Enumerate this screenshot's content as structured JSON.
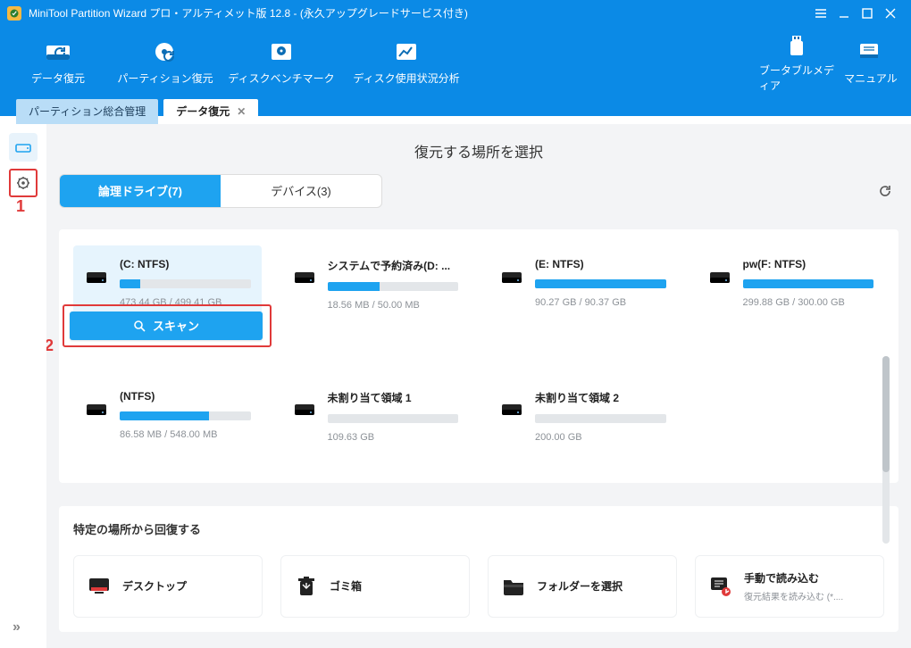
{
  "window": {
    "title": "MiniTool Partition Wizard プロ・アルティメット版 12.8 - (永久アップグレードサービス付き)"
  },
  "toolbar": {
    "data_recovery": "データ復元",
    "partition_recovery": "パーティション復元",
    "disk_benchmark": "ディスクベンチマーク",
    "disk_usage": "ディスク使用状況分析",
    "bootable_media": "ブータブルメディア",
    "manual": "マニュアル"
  },
  "tabs": {
    "tab1": "パーティション総合管理",
    "tab2": "データ復元"
  },
  "main": {
    "heading": "復元する場所を選択",
    "seg_logical": "論理ドライブ(7)",
    "seg_device": "デバイス(3)"
  },
  "drives": [
    {
      "name": "(C: NTFS)",
      "size": "473.44 GB / 499.41 GB",
      "fill": 16
    },
    {
      "name": "システムで予約済み(D: ...",
      "size": "18.56 MB / 50.00 MB",
      "fill": 40
    },
    {
      "name": "(E: NTFS)",
      "size": "90.27 GB / 90.37 GB",
      "fill": 100
    },
    {
      "name": "pw(F: NTFS)",
      "size": "299.88 GB / 300.00 GB",
      "fill": 100
    },
    {
      "name": "(NTFS)",
      "size": "86.58 MB / 548.00 MB",
      "fill": 68
    },
    {
      "name": "未割り当て領域 1",
      "size": "109.63 GB",
      "fill": 0
    },
    {
      "name": "未割り当て領域 2",
      "size": "200.00 GB",
      "fill": 0
    }
  ],
  "scan_label": "スキャン",
  "annot1": "1",
  "annot2": "2",
  "section2": {
    "title": "特定の場所から回復する",
    "desktop": "デスクトップ",
    "recycle": "ゴミ箱",
    "folder": "フォルダーを選択",
    "manual_load": "手動で読み込む",
    "manual_sub": "復元結果を読み込む (*...."
  }
}
